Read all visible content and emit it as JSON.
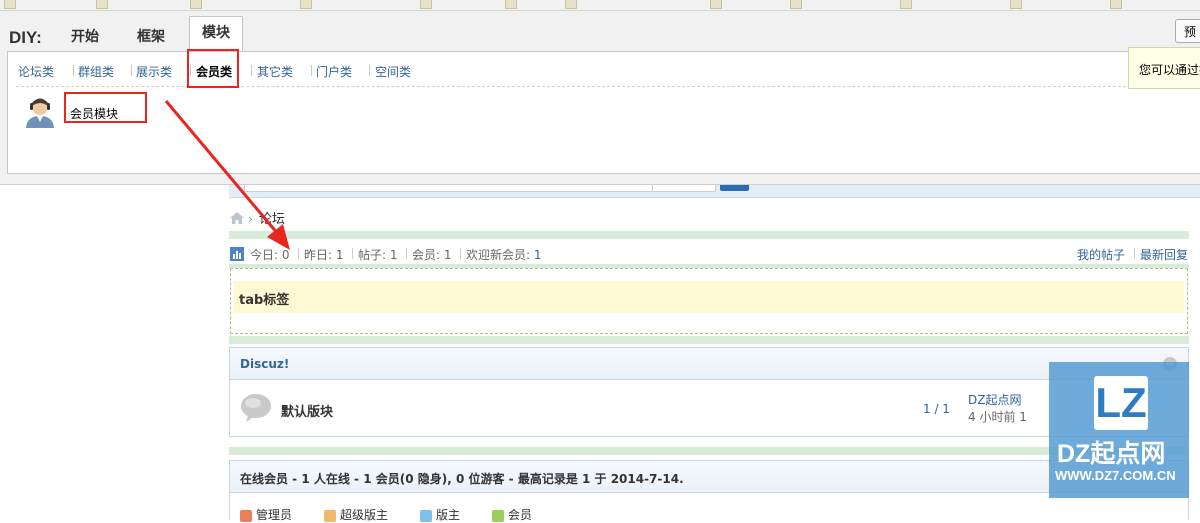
{
  "bookmarks": [],
  "diy": {
    "label": "DIY:",
    "tabs": [
      "开始",
      "框架",
      "模块"
    ],
    "active_tab": "模块",
    "subcategories": [
      "论坛类",
      "群组类",
      "展示类",
      "会员类",
      "其它类",
      "门户类",
      "空间类"
    ],
    "active_subcategory": "会员类",
    "modules": [
      {
        "label": "会员模块",
        "icon": "member-avatar-icon"
      }
    ],
    "preview_label": "预览",
    "tooltip": "您可以通过拖"
  },
  "forum": {
    "breadcrumb": "论坛",
    "stats": [
      {
        "label": "今日",
        "value": "0"
      },
      {
        "label": "昨日",
        "value": "1"
      },
      {
        "label": "帖子",
        "value": "1"
      },
      {
        "label": "会员",
        "value": "1"
      },
      {
        "label": "欢迎新会员",
        "value": "1"
      }
    ],
    "links": [
      "我的帖子",
      "最新回复"
    ],
    "tab_block_title": "tab标签",
    "category": {
      "title": "Discuz!",
      "forums": [
        {
          "name": "默认版块",
          "counts": "1 / 1",
          "last_author": "DZ起点网",
          "last_time": "4 小时前 1"
        }
      ]
    },
    "online": {
      "summary": "在线会员 - 1 人在线 - 1 会员(0 隐身), 0 位游客 - 最高记录是 1 于 2014-7-14.",
      "legend": [
        {
          "label": "管理员",
          "color": "#e8805a"
        },
        {
          "label": "超级版主",
          "color": "#f0b86a"
        },
        {
          "label": "版主",
          "color": "#7fc0ea"
        },
        {
          "label": "会员",
          "color": "#9bcf5a"
        }
      ]
    }
  },
  "watermark": {
    "mark": "LZ",
    "name": "DZ起点网",
    "url": "WWW.DZ7.COM.CN"
  },
  "colors": {
    "annotation_red": "#e8251f",
    "link_blue": "#336699",
    "watermark_blue": "#4f98d2"
  }
}
